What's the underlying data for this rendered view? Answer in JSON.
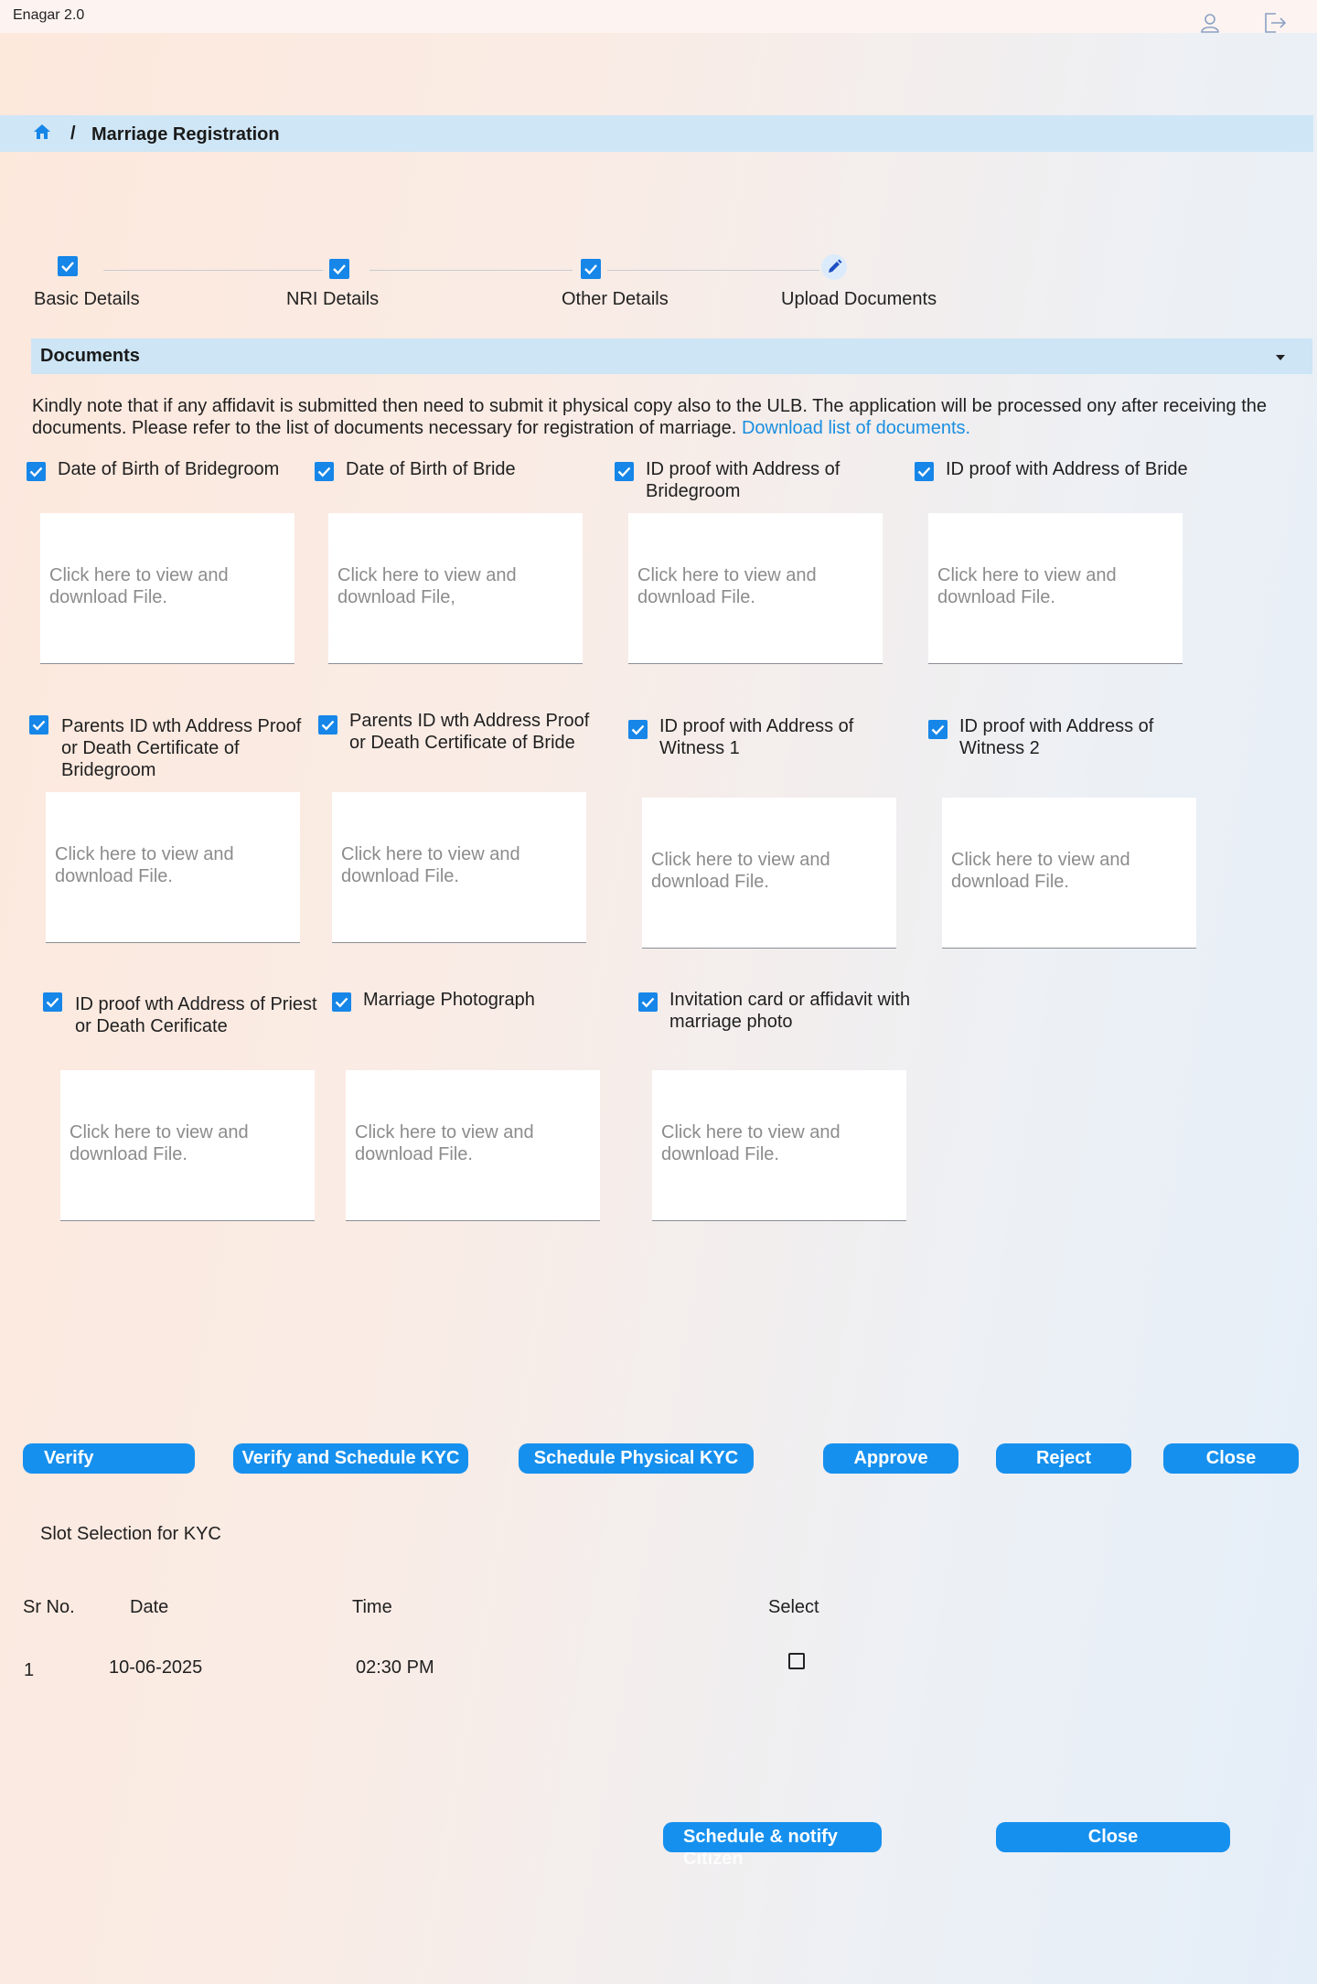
{
  "app": {
    "title": "Enagar 2.0"
  },
  "header_icons": [
    "user-icon",
    "logout-icon"
  ],
  "breadcrumb": {
    "home_icon": "home-icon",
    "separator": "/",
    "title": "Marriage Registration"
  },
  "stepper": {
    "steps": [
      {
        "label": "Basic Details",
        "state": "done"
      },
      {
        "label": "NRI Details",
        "state": "done"
      },
      {
        "label": "Other Details",
        "state": "done"
      },
      {
        "label": "Upload Documents",
        "state": "current"
      }
    ]
  },
  "documents": {
    "title": "Documents",
    "notice": "Kindly note that if any affidavit is submitted  then need to submit it physical copy also to the ULB. The application will be processed ony after receiving the documents. Please refer to the list of documents necessary for registration of marriage.",
    "download_link": "Download list of documents.",
    "items": [
      {
        "label": "Date of Birth of Bridegroom",
        "checked": true,
        "box_text": "Click here to view and download File."
      },
      {
        "label": "Date of Birth of Bride",
        "checked": true,
        "box_text": "Click here to view and download File,"
      },
      {
        "label": "ID proof with Address of Bridegroom",
        "checked": true,
        "box_text": "Click here to view and download File."
      },
      {
        "label": "ID proof with Address of Bride",
        "checked": true,
        "box_text": "Click here to view and download File."
      },
      {
        "label": "Parents ID wth Address Proof or Death Certificate of Bridegroom",
        "checked": true,
        "box_text": "Click here to view and download File."
      },
      {
        "label": "Parents ID wth Address Proof or Death Certificate of Bride",
        "checked": true,
        "box_text": "Click here to view and download File."
      },
      {
        "label": "ID proof with  Address of Witness 1",
        "checked": true,
        "box_text": "Click here to view and download File."
      },
      {
        "label": "ID proof with  Address of Witness 2",
        "checked": true,
        "box_text": "Click here to view and download File."
      },
      {
        "label": "ID proof wth Address of Priest or Death Cerificate",
        "checked": true,
        "box_text": "Click here to view and download File."
      },
      {
        "label": "Marriage Photograph",
        "checked": true,
        "box_text": "Click here to view and download File."
      },
      {
        "label": "Invitation card or affidavit with marriage photo",
        "checked": true,
        "box_text": "Click here to view and download File."
      }
    ]
  },
  "actions": {
    "verify": "Verify",
    "verify_schedule": "Verify and Schedule KYC",
    "schedule_physical": "Schedule Physical KYC",
    "approve": "Approve",
    "reject": "Reject",
    "close": "Close"
  },
  "slot": {
    "title": "Slot Selection for KYC",
    "columns": [
      "Sr No.",
      "Date",
      "Time",
      "Select"
    ],
    "rows": [
      {
        "sr": "1",
        "date": "10-06-2025",
        "time": "02:30 PM",
        "selected": false
      }
    ]
  },
  "bottom": {
    "schedule_notify": "Schedule & notify",
    "schedule_notify_overflow": "Citizen",
    "close": "Close"
  },
  "colors": {
    "accent": "#1690ee",
    "check": "#1686e8",
    "link": "#1a8fe0",
    "breadcrumb_bg": "#cfe6f6"
  }
}
